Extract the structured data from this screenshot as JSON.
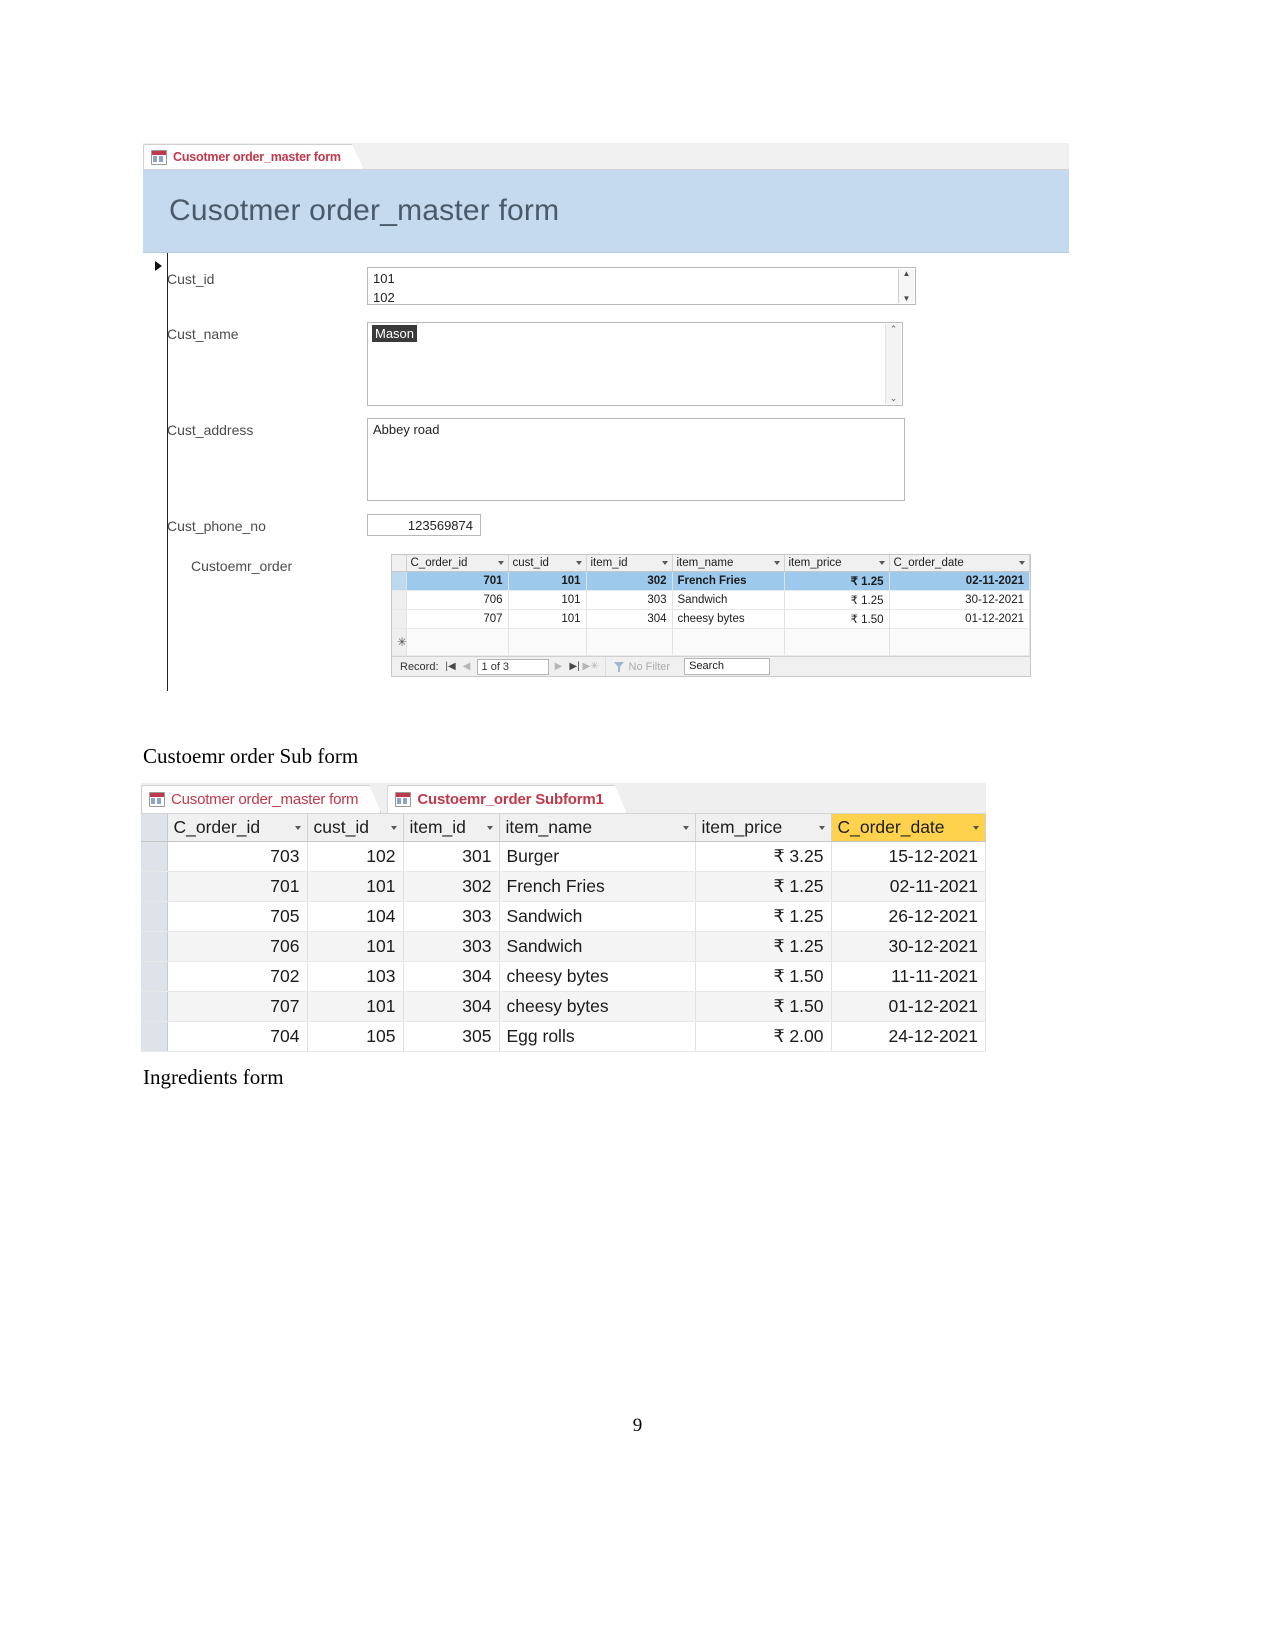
{
  "document": {
    "caption_subform": "Custoemr order Sub form",
    "caption_ingredients": "Ingredients form",
    "page_number": "9"
  },
  "master_form": {
    "tab": {
      "label": "Cusotmer order_master form",
      "icon": "form-datasheet-icon"
    },
    "title": "Cusotmer order_master form",
    "fields": {
      "cust_id": {
        "label": "Cust_id",
        "value": "101",
        "value2": "102"
      },
      "cust_name": {
        "label": "Cust_name",
        "value": "Mason"
      },
      "cust_address": {
        "label": "Cust_address",
        "value": "Abbey road"
      },
      "cust_phone_no": {
        "label": "Cust_phone_no",
        "value": "123569874"
      },
      "customer_order": {
        "label": "Custoemr_order"
      }
    },
    "subform": {
      "columns": [
        "C_order_id",
        "cust_id",
        "item_id",
        "item_name",
        "item_price",
        "C_order_date"
      ],
      "rows": [
        {
          "C_order_id": "701",
          "cust_id": "101",
          "item_id": "302",
          "item_name": "French Fries",
          "item_price": "₹ 1.25",
          "C_order_date": "02-11-2021",
          "selected": true
        },
        {
          "C_order_id": "706",
          "cust_id": "101",
          "item_id": "303",
          "item_name": "Sandwich",
          "item_price": "₹ 1.25",
          "C_order_date": "30-12-2021",
          "selected": false
        },
        {
          "C_order_id": "707",
          "cust_id": "101",
          "item_id": "304",
          "item_name": "cheesy bytes",
          "item_price": "₹ 1.50",
          "C_order_date": "01-12-2021",
          "selected": false
        }
      ],
      "new_row_marker": "✳",
      "navigator": {
        "record_label": "Record:",
        "first": "|◀",
        "prev": "◀",
        "position": "1 of 3",
        "next": "▶",
        "last": "▶|",
        "new": "▶✳",
        "filter_label": "No Filter",
        "filter_icon": "funnel-icon",
        "search_value": "Search"
      }
    }
  },
  "subform_window": {
    "tabs": [
      {
        "label": "Cusotmer order_master form",
        "active": false,
        "icon": "form-datasheet-icon"
      },
      {
        "label": "Custoemr_order Subform1",
        "active": true,
        "icon": "form-datasheet-icon"
      }
    ],
    "datasheet": {
      "columns": [
        "C_order_id",
        "cust_id",
        "item_id",
        "item_name",
        "item_price",
        "C_order_date"
      ],
      "sorted_column": "C_order_date",
      "sorted_color": "#ffd24d",
      "rows": [
        {
          "C_order_id": "703",
          "cust_id": "102",
          "item_id": "301",
          "item_name": "Burger",
          "item_price": "₹ 3.25",
          "C_order_date": "15-12-2021"
        },
        {
          "C_order_id": "701",
          "cust_id": "101",
          "item_id": "302",
          "item_name": "French Fries",
          "item_price": "₹ 1.25",
          "C_order_date": "02-11-2021"
        },
        {
          "C_order_id": "705",
          "cust_id": "104",
          "item_id": "303",
          "item_name": "Sandwich",
          "item_price": "₹ 1.25",
          "C_order_date": "26-12-2021"
        },
        {
          "C_order_id": "706",
          "cust_id": "101",
          "item_id": "303",
          "item_name": "Sandwich",
          "item_price": "₹ 1.25",
          "C_order_date": "30-12-2021"
        },
        {
          "C_order_id": "702",
          "cust_id": "103",
          "item_id": "304",
          "item_name": "cheesy bytes",
          "item_price": "₹ 1.50",
          "C_order_date": "11-11-2021"
        },
        {
          "C_order_id": "707",
          "cust_id": "101",
          "item_id": "304",
          "item_name": "cheesy bytes",
          "item_price": "₹ 1.50",
          "C_order_date": "01-12-2021"
        },
        {
          "C_order_id": "704",
          "cust_id": "105",
          "item_id": "305",
          "item_name": "Egg rolls",
          "item_price": "₹ 2.00",
          "C_order_date": "24-12-2021"
        }
      ]
    }
  }
}
